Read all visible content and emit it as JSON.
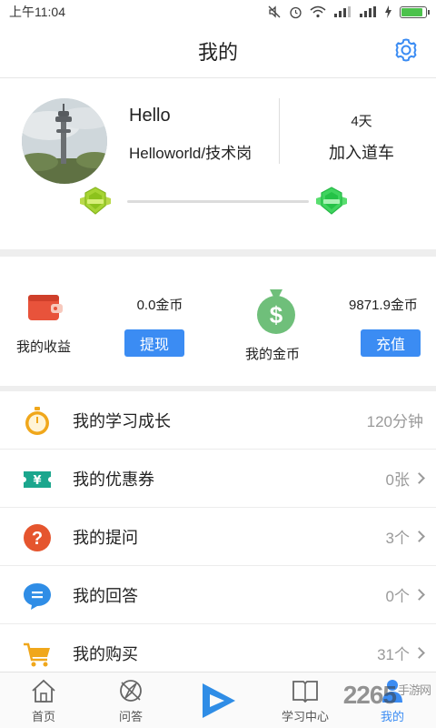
{
  "status_bar": {
    "time": "上午11:04"
  },
  "header": {
    "title": "我的",
    "settings_icon": "gear-icon"
  },
  "profile": {
    "name": "Hello",
    "subtitle": "Helloworld/技术岗",
    "days_value": "4天",
    "days_label": "加入道车"
  },
  "wallet": {
    "earnings_label": "我的收益",
    "earnings_value": "0.0金币",
    "withdraw_label": "提现",
    "gold_label": "我的金币",
    "gold_value": "9871.9金币",
    "recharge_label": "充值"
  },
  "menu": [
    {
      "label": "我的学习成长",
      "value": "120分钟",
      "icon": "stopwatch-icon",
      "has_chevron": false
    },
    {
      "label": "我的优惠券",
      "value": "0张",
      "icon": "coupon-icon",
      "has_chevron": true
    },
    {
      "label": "我的提问",
      "value": "3个",
      "icon": "question-icon",
      "has_chevron": true
    },
    {
      "label": "我的回答",
      "value": "0个",
      "icon": "chat-bubble-icon",
      "has_chevron": true
    },
    {
      "label": "我的购买",
      "value": "31个",
      "icon": "cart-icon",
      "has_chevron": true
    }
  ],
  "bottom_nav": [
    {
      "label": "首页",
      "icon": "home-icon"
    },
    {
      "label": "问答",
      "icon": "compass-icon"
    },
    {
      "label": "",
      "icon": "play-icon"
    },
    {
      "label": "学习中心",
      "icon": "book-icon"
    },
    {
      "label": "我的",
      "icon": "user-icon"
    }
  ],
  "colors": {
    "accent": "#3b8cf3",
    "badge_green": "#9bd63a",
    "money_green": "#6fbf7a"
  }
}
